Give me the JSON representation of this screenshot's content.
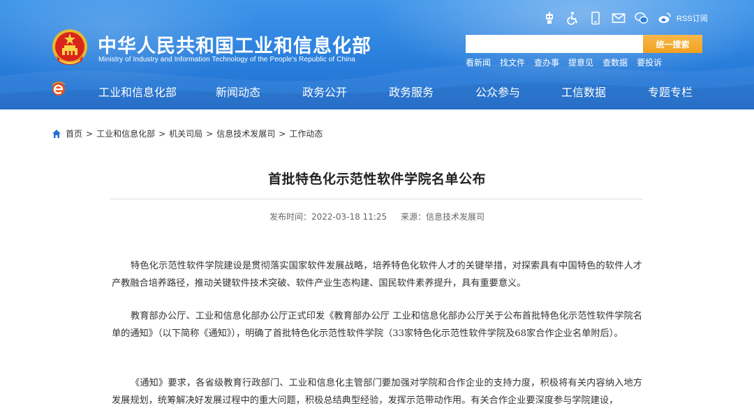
{
  "header": {
    "site_title": "中华人民共和国工业和信息化部",
    "site_subtitle": "Ministry of Industry and Information Technology of the People's Republic of China",
    "top_icons": [
      "accessibility-robot-icon",
      "wheelchair-icon",
      "mobile-icon",
      "mail-icon",
      "wechat-icon",
      "weibo-icon"
    ],
    "rss_label": "RSS订阅",
    "search": {
      "placeholder": "",
      "button_label": "统一搜索"
    },
    "quick_links": [
      "看新闻",
      "找文件",
      "查办事",
      "提意见",
      "查数据",
      "要投诉"
    ],
    "nav": [
      "工业和信息化部",
      "新闻动态",
      "政务公开",
      "政务服务",
      "公众参与",
      "工信数据",
      "专题专栏"
    ]
  },
  "breadcrumb": [
    "首页",
    "工业和信息化部",
    "机关司局",
    "信息技术发展司",
    "工作动态"
  ],
  "breadcrumb_separator": ">",
  "article": {
    "title": "首批特色化示范性软件学院名单公布",
    "publish_label": "发布时间：",
    "publish_time": "2022-03-18 11:25",
    "source_label": "来源：",
    "source": "信息技术发展司",
    "paragraphs": [
      "特色化示范性软件学院建设是贯彻落实国家软件发展战略，培养特色化软件人才的关键举措，对探索具有中国特色的软件人才产教融合培养路径，推动关键软件技术突破、软件产业生态构建、国民软件素养提升，具有重要意义。",
      "教育部办公厅、工业和信息化部办公厅正式印发《教育部办公厅  工业和信息化部办公厅关于公布首批特色化示范性软件学院名单的通知》（以下简称《通知》），明确了首批特色化示范性软件学院（33家特色化示范性软件学院及68家合作企业名单附后）。",
      "《通知》要求，各省级教育行政部门、工业和信息化主管部门要加强对学院和合作企业的支持力度，积极将有关内容纳入地方发展规划，统筹解决好发展过程中的重大问题，积极总结典型经验，发挥示范带动作用。有关合作企业要深度参与学院建设，"
    ]
  },
  "colors": {
    "header_blue": "#2a7fdc",
    "search_button": "#f5a623",
    "text": "#333333"
  }
}
